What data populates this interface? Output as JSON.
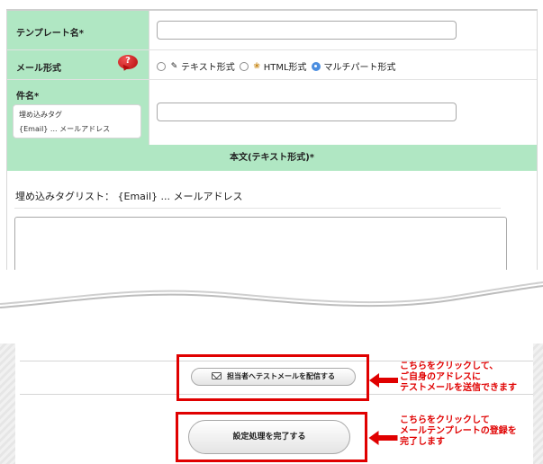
{
  "form": {
    "template_name_label": "テンプレート名*",
    "mail_format_label": "メール形式",
    "help_icon_text": "?",
    "format_options": [
      {
        "label": "テキスト形式",
        "icon": "pencil-icon",
        "selected": false
      },
      {
        "label": "HTML形式",
        "icon": "palette-icon",
        "selected": false
      },
      {
        "label": "マルチパート形式",
        "icon": "",
        "selected": true
      }
    ],
    "subject_label": "件名*",
    "embed_tag_title": "埋め込みタグ",
    "embed_tag_item": "{Email} ... メールアドレス",
    "body_section_title": "本文(テキスト形式)*",
    "tag_list_text": "埋め込みタグリスト： {Email} ... メールアドレス"
  },
  "actions": {
    "test_mail_button": "担当者へテストメールを配信する",
    "complete_button": "設定処理を完了する"
  },
  "annotations": {
    "test_mail_note": [
      "こちらをクリックして、",
      "ご自身のアドレスに",
      "テストメールを送信できます"
    ],
    "complete_note": [
      "こちらをクリックして",
      "メールテンプレートの登録を",
      "完了します"
    ]
  },
  "colors": {
    "header_green": "#b0e7c3",
    "annotation_red": "#e00000",
    "radio_selected": "#4b8ee0"
  }
}
